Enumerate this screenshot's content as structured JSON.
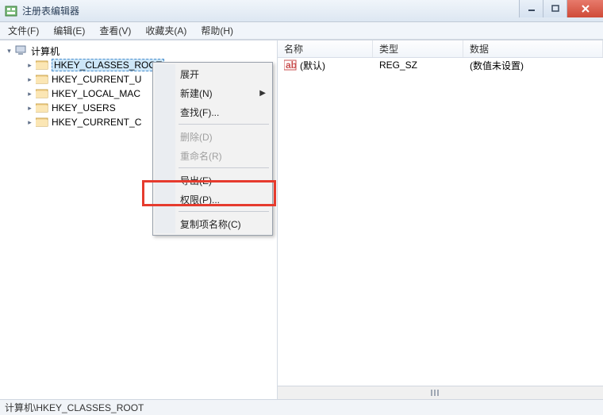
{
  "window": {
    "title": "注册表编辑器"
  },
  "menubar": {
    "file": "文件(F)",
    "edit": "编辑(E)",
    "view": "查看(V)",
    "favorites": "收藏夹(A)",
    "help": "帮助(H)"
  },
  "tree": {
    "root": "计算机",
    "items": [
      {
        "label": "HKEY_CLASSES_ROOT",
        "selected": true
      },
      {
        "label": "HKEY_CURRENT_U"
      },
      {
        "label": "HKEY_LOCAL_MAC"
      },
      {
        "label": "HKEY_USERS"
      },
      {
        "label": "HKEY_CURRENT_C"
      }
    ]
  },
  "list": {
    "headers": {
      "name": "名称",
      "type": "类型",
      "data": "数据"
    },
    "rows": [
      {
        "name": "(默认)",
        "type": "REG_SZ",
        "data": "(数值未设置)"
      }
    ]
  },
  "context_menu": {
    "expand": "展开",
    "new": "新建(N)",
    "find": "查找(F)...",
    "delete": "删除(D)",
    "rename": "重命名(R)",
    "export": "导出(E)",
    "permissions": "权限(P)...",
    "copy_key_name": "复制项名称(C)"
  },
  "statusbar": {
    "path": "计算机\\HKEY_CLASSES_ROOT"
  }
}
